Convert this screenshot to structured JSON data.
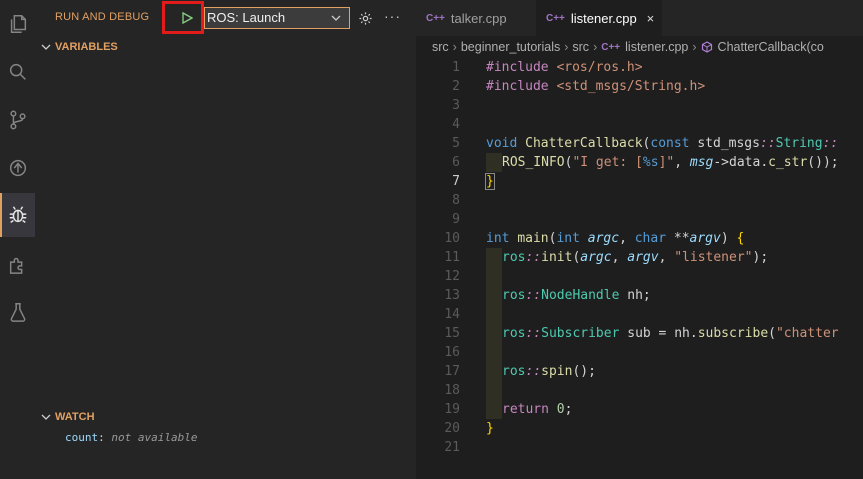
{
  "debug": {
    "title": "RUN AND DEBUG",
    "launch_config": "ROS: Launch",
    "more": "···",
    "sections": {
      "variables": "VARIABLES",
      "watch": "WATCH"
    },
    "watch": {
      "name": "count",
      "sep": ": ",
      "value": "not available"
    }
  },
  "activity_bar": {
    "items": [
      "explorer-icon",
      "search-icon",
      "source-control-icon",
      "run-icon",
      "debug-icon",
      "extensions-icon",
      "testing-icon"
    ],
    "active": "debug-icon",
    "accent": "#e0a060"
  },
  "tabs": [
    {
      "icon": "C++",
      "label": "talker.cpp",
      "active": false
    },
    {
      "icon": "C++",
      "label": "listener.cpp",
      "active": true,
      "close": "×"
    }
  ],
  "breadcrumb": {
    "parts": [
      "src",
      "beginner_tutorials",
      "src"
    ],
    "file_icon": "C++",
    "file": "listener.cpp",
    "symbol": "ChatterCallback(co"
  },
  "editor": {
    "current_line": 7,
    "line_numbers": [
      "1",
      "2",
      "3",
      "4",
      "5",
      "6",
      "7",
      "8",
      "9",
      "10",
      "11",
      "12",
      "13",
      "14",
      "15",
      "16",
      "17",
      "18",
      "19",
      "20",
      "21"
    ],
    "lines": [
      {
        "n": 1,
        "tokens": [
          {
            "t": "#include ",
            "c": "pre"
          },
          {
            "t": "<ros/ros.h>",
            "c": "inc"
          }
        ]
      },
      {
        "n": 2,
        "tokens": [
          {
            "t": "#include ",
            "c": "pre"
          },
          {
            "t": "<std_msgs/String.h>",
            "c": "inc"
          }
        ]
      },
      {
        "n": 3,
        "tokens": []
      },
      {
        "n": 4,
        "tokens": []
      },
      {
        "n": 5,
        "tokens": [
          {
            "t": "void ",
            "c": "kw"
          },
          {
            "t": "ChatterCallback",
            "c": "fn"
          },
          {
            "t": "(",
            "c": "txt"
          },
          {
            "t": "const ",
            "c": "kw"
          },
          {
            "t": "std_msgs",
            "c": "txt"
          },
          {
            "t": "::",
            "c": "pre ital"
          },
          {
            "t": "String",
            "c": "ns"
          },
          {
            "t": "::",
            "c": "pre ital"
          }
        ]
      },
      {
        "n": 6,
        "guide": true,
        "tokens": [
          {
            "t": "ROS_INFO",
            "c": "fn"
          },
          {
            "t": "(",
            "c": "txt"
          },
          {
            "t": "\"I get: [",
            "c": "str"
          },
          {
            "t": "%s",
            "c": "kw"
          },
          {
            "t": "]\"",
            "c": "str"
          },
          {
            "t": ", ",
            "c": "txt"
          },
          {
            "t": "msg",
            "c": "par"
          },
          {
            "t": "->",
            "c": "txt"
          },
          {
            "t": "data",
            "c": "txt"
          },
          {
            "t": ".",
            "c": "txt"
          },
          {
            "t": "c_str",
            "c": "fn"
          },
          {
            "t": "());",
            "c": "txt"
          }
        ]
      },
      {
        "n": 7,
        "tokens": [
          {
            "t": "}",
            "c": "brace match"
          }
        ]
      },
      {
        "n": 8,
        "tokens": []
      },
      {
        "n": 9,
        "tokens": []
      },
      {
        "n": 10,
        "tokens": [
          {
            "t": "int ",
            "c": "kw"
          },
          {
            "t": "main",
            "c": "fn"
          },
          {
            "t": "(",
            "c": "txt"
          },
          {
            "t": "int ",
            "c": "kw"
          },
          {
            "t": "argc",
            "c": "par"
          },
          {
            "t": ", ",
            "c": "txt"
          },
          {
            "t": "char ",
            "c": "kw"
          },
          {
            "t": "**",
            "c": "txt"
          },
          {
            "t": "argv",
            "c": "par"
          },
          {
            "t": ") ",
            "c": "txt"
          },
          {
            "t": "{",
            "c": "brace"
          }
        ]
      },
      {
        "n": 11,
        "guide": true,
        "tokens": [
          {
            "t": "ros",
            "c": "ns"
          },
          {
            "t": "::",
            "c": "pre ital"
          },
          {
            "t": "init",
            "c": "fn"
          },
          {
            "t": "(",
            "c": "txt"
          },
          {
            "t": "argc",
            "c": "par"
          },
          {
            "t": ", ",
            "c": "txt"
          },
          {
            "t": "argv",
            "c": "par"
          },
          {
            "t": ", ",
            "c": "txt"
          },
          {
            "t": "\"listener\"",
            "c": "str"
          },
          {
            "t": ");",
            "c": "txt"
          }
        ]
      },
      {
        "n": 12,
        "guide": true,
        "tokens": []
      },
      {
        "n": 13,
        "guide": true,
        "tokens": [
          {
            "t": "ros",
            "c": "ns"
          },
          {
            "t": "::",
            "c": "pre ital"
          },
          {
            "t": "NodeHandle",
            "c": "ns"
          },
          {
            "t": " nh;",
            "c": "txt"
          }
        ]
      },
      {
        "n": 14,
        "guide": true,
        "tokens": []
      },
      {
        "n": 15,
        "guide": true,
        "tokens": [
          {
            "t": "ros",
            "c": "ns"
          },
          {
            "t": "::",
            "c": "pre ital"
          },
          {
            "t": "Subscriber",
            "c": "ns"
          },
          {
            "t": " sub = nh.",
            "c": "txt"
          },
          {
            "t": "subscribe",
            "c": "fn"
          },
          {
            "t": "(",
            "c": "txt"
          },
          {
            "t": "\"chatter",
            "c": "str"
          }
        ]
      },
      {
        "n": 16,
        "guide": true,
        "tokens": []
      },
      {
        "n": 17,
        "guide": true,
        "tokens": [
          {
            "t": "ros",
            "c": "ns"
          },
          {
            "t": "::",
            "c": "pre ital"
          },
          {
            "t": "spin",
            "c": "fn"
          },
          {
            "t": "();",
            "c": "txt"
          }
        ]
      },
      {
        "n": 18,
        "guide": true,
        "tokens": []
      },
      {
        "n": 19,
        "guide": true,
        "tokens": [
          {
            "t": "return ",
            "c": "pre"
          },
          {
            "t": "0",
            "c": "num"
          },
          {
            "t": ";",
            "c": "txt"
          }
        ]
      },
      {
        "n": 20,
        "tokens": [
          {
            "t": "}",
            "c": "brace"
          }
        ]
      },
      {
        "n": 21,
        "tokens": []
      }
    ]
  }
}
